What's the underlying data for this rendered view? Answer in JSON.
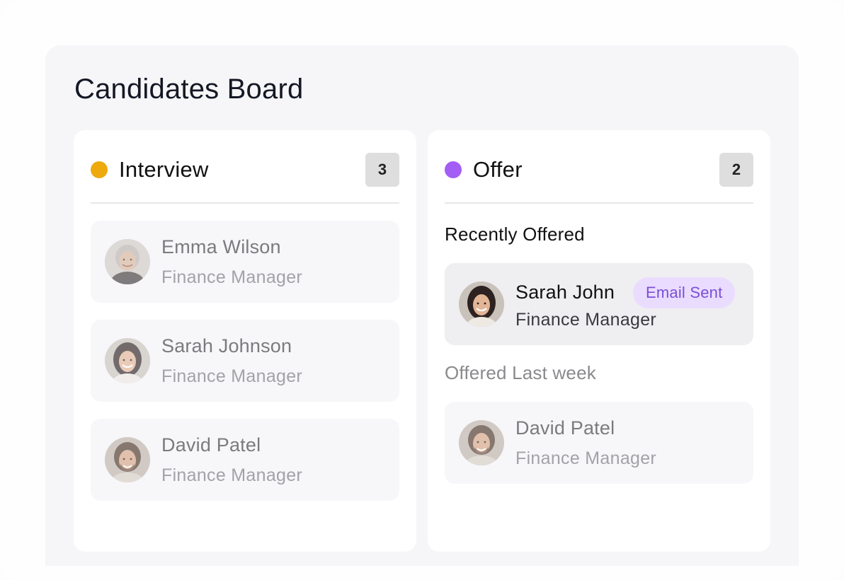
{
  "board": {
    "title": "Candidates Board"
  },
  "columns": {
    "interview": {
      "title": "Interview",
      "count": "3",
      "dot_color": "#eeaa0c",
      "cards": [
        {
          "name": "Emma Wilson",
          "role": "Finance Manager",
          "avatar": "elderly-woman-avatar"
        },
        {
          "name": "Sarah Johnson",
          "role": "Finance Manager",
          "avatar": "woman-avatar"
        },
        {
          "name": "David Patel",
          "role": "Finance Manager",
          "avatar": "man-avatar"
        }
      ]
    },
    "offer": {
      "title": "Offer",
      "count": "2",
      "dot_color": "#a35ef5",
      "recent_label": "Recently Offered",
      "last_week_label": "Offered Last week",
      "recent_card": {
        "name": "Sarah John",
        "role": "Finance Manager",
        "status": "Email Sent",
        "avatar": "woman-avatar"
      },
      "last_week_card": {
        "name": "David Patel",
        "role": "Finance Manager",
        "avatar": "man-avatar"
      }
    }
  },
  "colors": {
    "accent_purple": "#7b4fd6",
    "badge_purple_bg": "#eadcff",
    "board_bg": "#f6f5f8",
    "column_bg": "#ffffff"
  }
}
